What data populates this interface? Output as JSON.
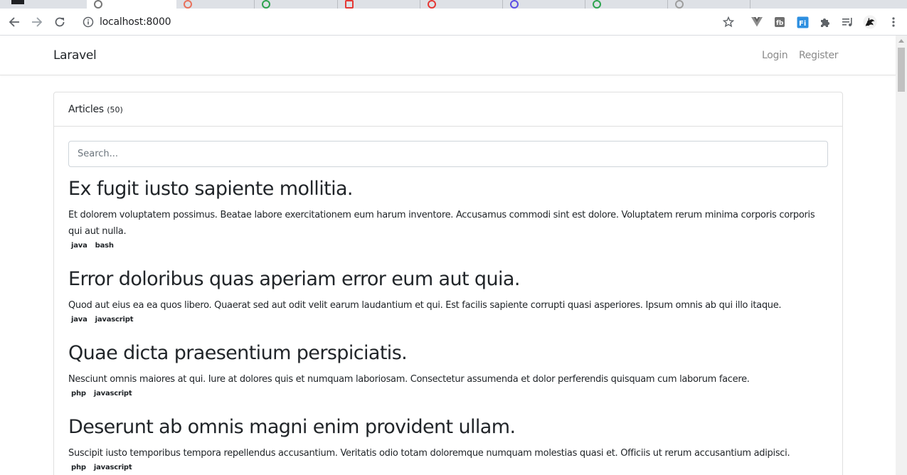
{
  "browser": {
    "url": "localhost:8000"
  },
  "app": {
    "brand": "Laravel",
    "nav": {
      "login": "Login",
      "register": "Register"
    }
  },
  "articles_panel": {
    "title": "Articles",
    "count": "(50)",
    "search_placeholder": "Search...",
    "items": [
      {
        "title": "Ex fugit iusto sapiente mollitia.",
        "body": "Et dolorem voluptatem possimus. Beatae labore exercitationem eum harum inventore. Accusamus commodi sint est dolore. Voluptatem rerum minima corporis corporis qui aut nulla.",
        "tags": [
          "java",
          "bash"
        ]
      },
      {
        "title": "Error doloribus quas aperiam error eum aut quia.",
        "body": "Quod aut eius ea ea quos libero. Quaerat sed aut odit velit earum laudantium et qui. Est facilis sapiente corrupti quasi asperiores. Ipsum omnis ab qui illo itaque.",
        "tags": [
          "java",
          "javascript"
        ]
      },
      {
        "title": "Quae dicta praesentium perspiciatis.",
        "body": "Nesciunt omnis maiores at qui. Iure at dolores quis et numquam laboriosam. Consectetur assumenda et dolor perferendis quisquam cum laborum facere.",
        "tags": [
          "php",
          "javascript"
        ]
      },
      {
        "title": "Deserunt ab omnis magni enim provident ullam.",
        "body": "Suscipit iusto temporibus tempora repellendus accusantium. Veritatis odio totam doloremque numquam molestias quasi et. Officiis ut rerum accusantium adipisci.",
        "tags": [
          "php",
          "javascript"
        ]
      }
    ]
  }
}
